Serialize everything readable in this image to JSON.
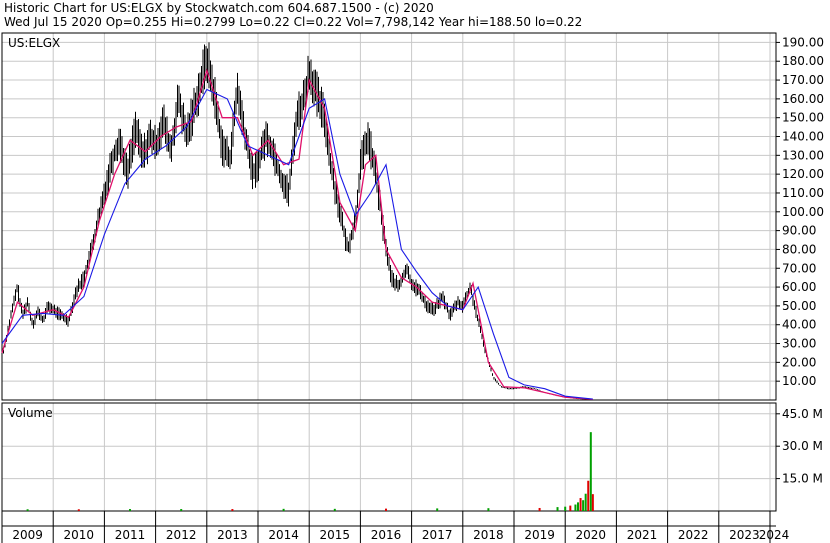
{
  "header": {
    "line1": "Historic Chart for US:ELGX by Stockwatch.com 604.687.1500 - (c) 2020",
    "line2": "Wed Jul 15 2020  Op=0.255  Hi=0.2799  Lo=0.22  Cl=0.22  Vol=7,798,142  Year hi=188.50  lo=0.22"
  },
  "colors": {
    "background": "#ffffff",
    "grid": "#c8c8c8",
    "price_bars": "#000000",
    "ma_short": "#e0106a",
    "ma_long": "#1a1ae6",
    "volume_up": "#00a000",
    "volume_down": "#e00000"
  },
  "chart_data": [
    {
      "type": "line",
      "title": "US:ELGX",
      "ylim": [
        0,
        195
      ],
      "yticks": [
        10,
        20,
        30,
        40,
        50,
        60,
        70,
        80,
        90,
        100,
        110,
        120,
        130,
        140,
        150,
        160,
        170,
        180,
        190
      ],
      "ytick_labels": [
        "10.00",
        "20.00",
        "30.00",
        "40.00",
        "50.00",
        "60.00",
        "70.00",
        "80.00",
        "90.00",
        "100.00",
        "110.00",
        "120.00",
        "130.00",
        "140.00",
        "150.00",
        "160.00",
        "170.00",
        "180.00",
        "190.00"
      ],
      "grid": true,
      "series": [
        {
          "style": "ohlc-bars",
          "x": [
            2009.0,
            2009.1,
            2009.2,
            2009.3,
            2009.4,
            2009.5,
            2009.6,
            2009.7,
            2009.8,
            2009.9,
            2010.0,
            2010.15,
            2010.3,
            2010.45,
            2010.6,
            2010.75,
            2010.9,
            2011.0,
            2011.15,
            2011.3,
            2011.45,
            2011.6,
            2011.75,
            2011.9,
            2012.0,
            2012.15,
            2012.3,
            2012.45,
            2012.6,
            2012.75,
            2012.9,
            2013.0,
            2013.15,
            2013.3,
            2013.45,
            2013.6,
            2013.75,
            2013.9,
            2014.0,
            2014.15,
            2014.3,
            2014.45,
            2014.6,
            2014.75,
            2014.9,
            2015.0,
            2015.15,
            2015.3,
            2015.45,
            2015.6,
            2015.75,
            2015.9,
            2016.0,
            2016.15,
            2016.3,
            2016.45,
            2016.6,
            2016.75,
            2016.9,
            2017.0,
            2017.15,
            2017.3,
            2017.45,
            2017.6,
            2017.75,
            2017.9,
            2018.0,
            2018.15,
            2018.3,
            2018.45,
            2018.6,
            2018.75,
            2018.9,
            2019.0,
            2019.2,
            2019.4,
            2019.6,
            2019.8,
            2020.0,
            2020.2,
            2020.4,
            2020.54
          ],
          "values": [
            22,
            35,
            48,
            60,
            45,
            52,
            40,
            47,
            42,
            50,
            48,
            45,
            42,
            58,
            65,
            80,
            98,
            110,
            128,
            138,
            120,
            145,
            130,
            140,
            135,
            148,
            132,
            160,
            140,
            155,
            170,
            182,
            162,
            135,
            128,
            165,
            140,
            120,
            125,
            140,
            132,
            118,
            110,
            150,
            160,
            175,
            162,
            150,
            120,
            100,
            80,
            95,
            125,
            140,
            120,
            90,
            65,
            60,
            70,
            62,
            58,
            50,
            48,
            55,
            45,
            52,
            50,
            60,
            42,
            25,
            12,
            7,
            6,
            6,
            7,
            6,
            4,
            2.5,
            1.5,
            0.8,
            0.4,
            0.22
          ]
        },
        {
          "style": "moving-average-short",
          "x": [
            2009.0,
            2009.3,
            2009.6,
            2010.0,
            2010.3,
            2010.6,
            2010.9,
            2011.2,
            2011.5,
            2011.8,
            2012.1,
            2012.4,
            2012.7,
            2013.0,
            2013.3,
            2013.6,
            2013.9,
            2014.2,
            2014.5,
            2014.8,
            2015.0,
            2015.3,
            2015.6,
            2015.9,
            2016.1,
            2016.3,
            2016.5,
            2016.8,
            2017.1,
            2017.4,
            2017.7,
            2018.0,
            2018.2,
            2018.5,
            2018.8,
            2019.2,
            2019.6,
            2020.0,
            2020.54
          ],
          "values": [
            25,
            52,
            45,
            48,
            44,
            60,
            95,
            120,
            138,
            132,
            140,
            145,
            148,
            175,
            150,
            150,
            130,
            138,
            125,
            128,
            170,
            155,
            105,
            90,
            125,
            130,
            80,
            65,
            60,
            52,
            50,
            48,
            62,
            20,
            7,
            6.5,
            4,
            1.5,
            0.3
          ]
        },
        {
          "style": "moving-average-long",
          "x": [
            2009.0,
            2009.4,
            2009.8,
            2010.2,
            2010.6,
            2011.0,
            2011.4,
            2011.8,
            2012.2,
            2012.6,
            2013.0,
            2013.4,
            2013.8,
            2014.2,
            2014.6,
            2015.0,
            2015.3,
            2015.6,
            2015.9,
            2016.2,
            2016.5,
            2016.8,
            2017.1,
            2017.4,
            2017.7,
            2018.0,
            2018.3,
            2018.6,
            2018.9,
            2019.2,
            2019.6,
            2020.0,
            2020.54
          ],
          "values": [
            30,
            45,
            46,
            45,
            55,
            88,
            115,
            128,
            135,
            145,
            165,
            160,
            135,
            130,
            125,
            155,
            160,
            120,
            98,
            110,
            125,
            80,
            68,
            57,
            50,
            48,
            60,
            35,
            12,
            8,
            6,
            2,
            0.5
          ]
        }
      ]
    },
    {
      "type": "bar",
      "title": "Volume",
      "ylim": [
        0,
        50
      ],
      "yticks": [
        15,
        30,
        45
      ],
      "ytick_labels": [
        "15.0 M",
        "30.0 M",
        "45.0 M"
      ],
      "x_categories": [
        "2009",
        "2010",
        "2011",
        "2012",
        "2013",
        "2014",
        "2015",
        "2016",
        "2017",
        "2018",
        "2019",
        "2020",
        "2021",
        "2022",
        "2023",
        "2024"
      ],
      "series": [
        {
          "name": "",
          "x": [
            2009.5,
            2010.5,
            2011.5,
            2012.5,
            2013.5,
            2014.5,
            2015.5,
            2016.5,
            2017.5,
            2018.5,
            2019.5,
            2019.85,
            2020.0,
            2020.1,
            2020.2,
            2020.25,
            2020.3,
            2020.35,
            2020.4,
            2020.45,
            2020.5,
            2020.54
          ],
          "values": [
            0.8,
            0.8,
            0.9,
            0.9,
            0.9,
            1.0,
            1.0,
            1.1,
            1.2,
            1.3,
            1.4,
            1.8,
            2.0,
            2.5,
            3.0,
            4.0,
            6.0,
            5.0,
            8.0,
            14.0,
            36.5,
            7.8
          ]
        }
      ]
    }
  ]
}
